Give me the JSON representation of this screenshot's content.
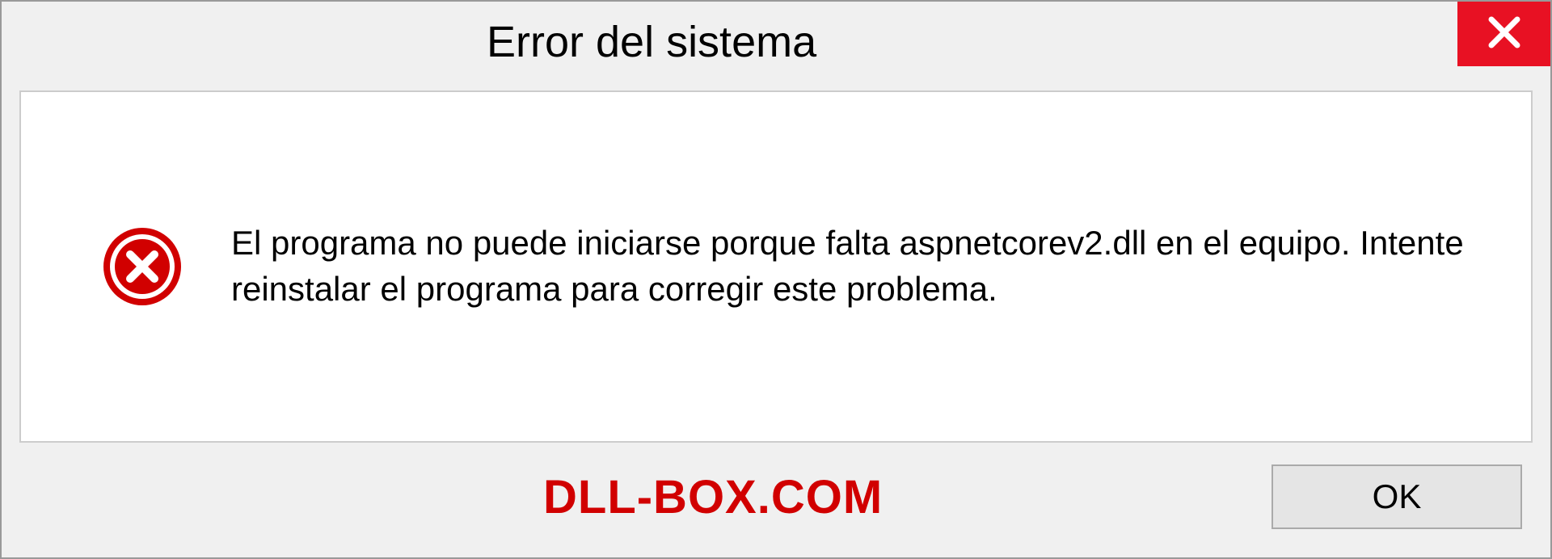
{
  "dialog": {
    "title": "Error del sistema",
    "message": "El programa no puede iniciarse porque falta aspnetcorev2.dll en el equipo. Intente reinstalar el programa para corregir este problema.",
    "ok_label": "OK"
  },
  "watermark": "DLL-BOX.COM"
}
